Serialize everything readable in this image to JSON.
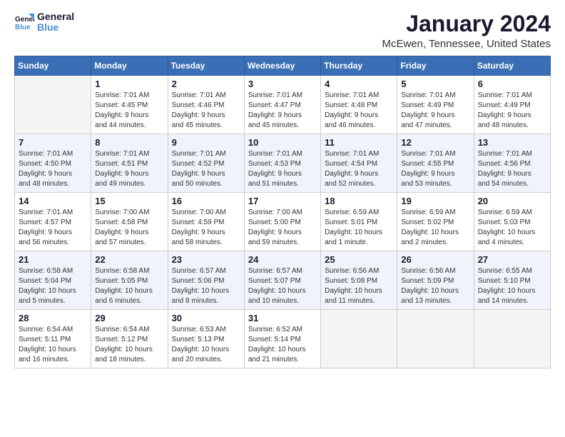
{
  "logo": {
    "line1": "General",
    "line2": "Blue"
  },
  "title": "January 2024",
  "location": "McEwen, Tennessee, United States",
  "days_of_week": [
    "Sunday",
    "Monday",
    "Tuesday",
    "Wednesday",
    "Thursday",
    "Friday",
    "Saturday"
  ],
  "weeks": [
    [
      {
        "day": "",
        "info": ""
      },
      {
        "day": "1",
        "info": "Sunrise: 7:01 AM\nSunset: 4:45 PM\nDaylight: 9 hours\nand 44 minutes."
      },
      {
        "day": "2",
        "info": "Sunrise: 7:01 AM\nSunset: 4:46 PM\nDaylight: 9 hours\nand 45 minutes."
      },
      {
        "day": "3",
        "info": "Sunrise: 7:01 AM\nSunset: 4:47 PM\nDaylight: 9 hours\nand 45 minutes."
      },
      {
        "day": "4",
        "info": "Sunrise: 7:01 AM\nSunset: 4:48 PM\nDaylight: 9 hours\nand 46 minutes."
      },
      {
        "day": "5",
        "info": "Sunrise: 7:01 AM\nSunset: 4:49 PM\nDaylight: 9 hours\nand 47 minutes."
      },
      {
        "day": "6",
        "info": "Sunrise: 7:01 AM\nSunset: 4:49 PM\nDaylight: 9 hours\nand 48 minutes."
      }
    ],
    [
      {
        "day": "7",
        "info": "Sunrise: 7:01 AM\nSunset: 4:50 PM\nDaylight: 9 hours\nand 48 minutes."
      },
      {
        "day": "8",
        "info": "Sunrise: 7:01 AM\nSunset: 4:51 PM\nDaylight: 9 hours\nand 49 minutes."
      },
      {
        "day": "9",
        "info": "Sunrise: 7:01 AM\nSunset: 4:52 PM\nDaylight: 9 hours\nand 50 minutes."
      },
      {
        "day": "10",
        "info": "Sunrise: 7:01 AM\nSunset: 4:53 PM\nDaylight: 9 hours\nand 51 minutes."
      },
      {
        "day": "11",
        "info": "Sunrise: 7:01 AM\nSunset: 4:54 PM\nDaylight: 9 hours\nand 52 minutes."
      },
      {
        "day": "12",
        "info": "Sunrise: 7:01 AM\nSunset: 4:55 PM\nDaylight: 9 hours\nand 53 minutes."
      },
      {
        "day": "13",
        "info": "Sunrise: 7:01 AM\nSunset: 4:56 PM\nDaylight: 9 hours\nand 54 minutes."
      }
    ],
    [
      {
        "day": "14",
        "info": "Sunrise: 7:01 AM\nSunset: 4:57 PM\nDaylight: 9 hours\nand 56 minutes."
      },
      {
        "day": "15",
        "info": "Sunrise: 7:00 AM\nSunset: 4:58 PM\nDaylight: 9 hours\nand 57 minutes."
      },
      {
        "day": "16",
        "info": "Sunrise: 7:00 AM\nSunset: 4:59 PM\nDaylight: 9 hours\nand 58 minutes."
      },
      {
        "day": "17",
        "info": "Sunrise: 7:00 AM\nSunset: 5:00 PM\nDaylight: 9 hours\nand 59 minutes."
      },
      {
        "day": "18",
        "info": "Sunrise: 6:59 AM\nSunset: 5:01 PM\nDaylight: 10 hours\nand 1 minute."
      },
      {
        "day": "19",
        "info": "Sunrise: 6:59 AM\nSunset: 5:02 PM\nDaylight: 10 hours\nand 2 minutes."
      },
      {
        "day": "20",
        "info": "Sunrise: 6:59 AM\nSunset: 5:03 PM\nDaylight: 10 hours\nand 4 minutes."
      }
    ],
    [
      {
        "day": "21",
        "info": "Sunrise: 6:58 AM\nSunset: 5:04 PM\nDaylight: 10 hours\nand 5 minutes."
      },
      {
        "day": "22",
        "info": "Sunrise: 6:58 AM\nSunset: 5:05 PM\nDaylight: 10 hours\nand 6 minutes."
      },
      {
        "day": "23",
        "info": "Sunrise: 6:57 AM\nSunset: 5:06 PM\nDaylight: 10 hours\nand 8 minutes."
      },
      {
        "day": "24",
        "info": "Sunrise: 6:57 AM\nSunset: 5:07 PM\nDaylight: 10 hours\nand 10 minutes."
      },
      {
        "day": "25",
        "info": "Sunrise: 6:56 AM\nSunset: 5:08 PM\nDaylight: 10 hours\nand 11 minutes."
      },
      {
        "day": "26",
        "info": "Sunrise: 6:56 AM\nSunset: 5:09 PM\nDaylight: 10 hours\nand 13 minutes."
      },
      {
        "day": "27",
        "info": "Sunrise: 6:55 AM\nSunset: 5:10 PM\nDaylight: 10 hours\nand 14 minutes."
      }
    ],
    [
      {
        "day": "28",
        "info": "Sunrise: 6:54 AM\nSunset: 5:11 PM\nDaylight: 10 hours\nand 16 minutes."
      },
      {
        "day": "29",
        "info": "Sunrise: 6:54 AM\nSunset: 5:12 PM\nDaylight: 10 hours\nand 18 minutes."
      },
      {
        "day": "30",
        "info": "Sunrise: 6:53 AM\nSunset: 5:13 PM\nDaylight: 10 hours\nand 20 minutes."
      },
      {
        "day": "31",
        "info": "Sunrise: 6:52 AM\nSunset: 5:14 PM\nDaylight: 10 hours\nand 21 minutes."
      },
      {
        "day": "",
        "info": ""
      },
      {
        "day": "",
        "info": ""
      },
      {
        "day": "",
        "info": ""
      }
    ]
  ]
}
